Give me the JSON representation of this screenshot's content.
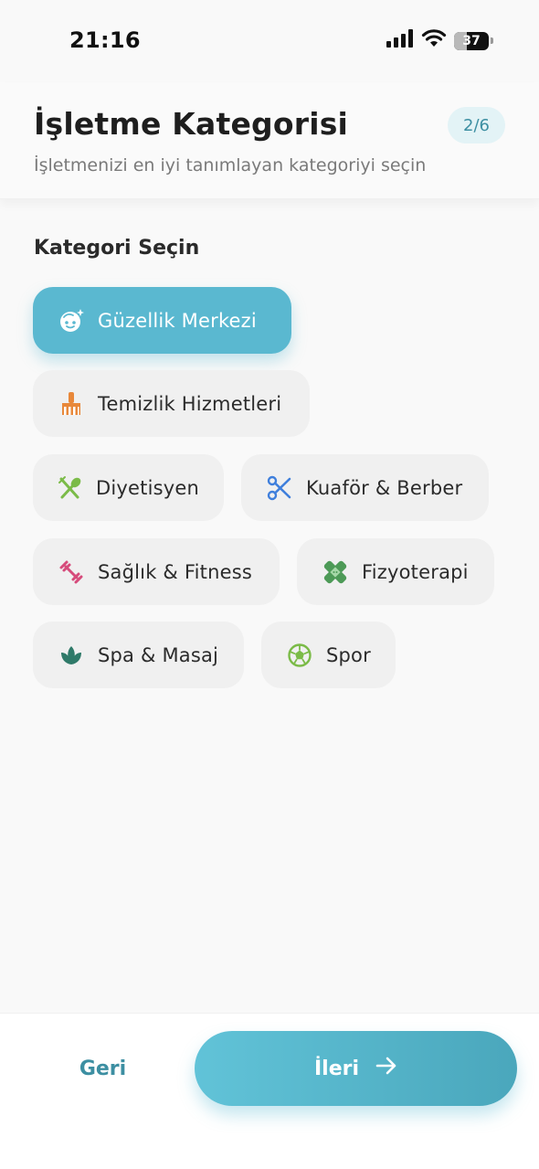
{
  "status_bar": {
    "time": "21:16",
    "battery": "37"
  },
  "header": {
    "title": "İşletme Kategorisi",
    "subtitle": "İşletmenizi en iyi tanımlayan kategoriyi seçin",
    "step": "2/6"
  },
  "section": {
    "label": "Kategori Seçin"
  },
  "categories": [
    {
      "label": "Güzellik Merkezi",
      "icon": "face-sparkle-icon",
      "selected": true
    },
    {
      "label": "Temizlik Hizmetleri",
      "icon": "broom-icon",
      "color": "#e8883a"
    },
    {
      "label": "Diyetisyen",
      "icon": "fork-spoon-icon",
      "color": "#7bbb48"
    },
    {
      "label": "Kuaför & Berber",
      "icon": "scissors-icon",
      "color": "#3f7fdc"
    },
    {
      "label": "Sağlık & Fitness",
      "icon": "dumbbell-icon",
      "color": "#d64b7b"
    },
    {
      "label": "Fizyoterapi",
      "icon": "bandage-icon",
      "color": "#4d9a57"
    },
    {
      "label": "Spa & Masaj",
      "icon": "lotus-icon",
      "color": "#2f7a69"
    },
    {
      "label": "Spor",
      "icon": "soccer-ball-icon",
      "color": "#7bbb48"
    }
  ],
  "footer": {
    "back_label": "Geri",
    "next_label": "İleri"
  },
  "colors": {
    "accent": "#5ab8d0",
    "accent_text": "#3d8fa2"
  }
}
